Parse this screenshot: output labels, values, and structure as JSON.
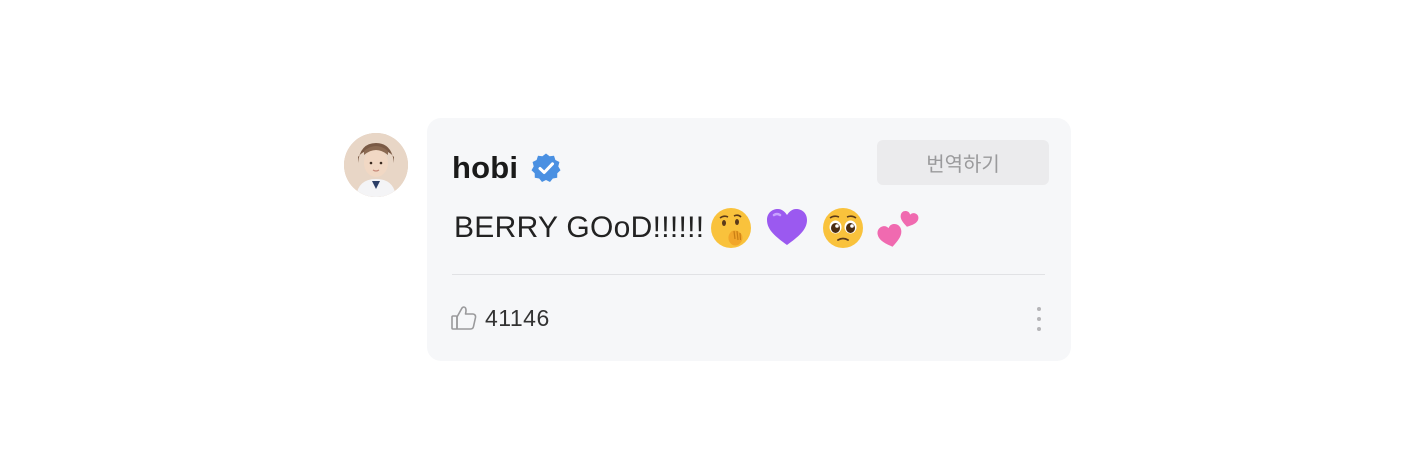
{
  "comment": {
    "username": "hobi",
    "verified": true,
    "translate_label": "번역하기",
    "text": "BERRY GOoD!!!!!!",
    "emojis": [
      "shushing-face",
      "purple-heart",
      "pleading-face",
      "two-hearts"
    ],
    "like_count": "41146"
  },
  "colors": {
    "bubble_background": "#f6f7f9",
    "verified_badge": "#4a90e2",
    "translate_button": "#ebebed",
    "purple_heart": "#9b59f0",
    "pink_heart": "#f06ab0"
  },
  "icons": {
    "avatar": "user-avatar",
    "verified": "verified-badge-icon",
    "like": "thumbs-up-icon",
    "more": "more-vertical-icon"
  }
}
